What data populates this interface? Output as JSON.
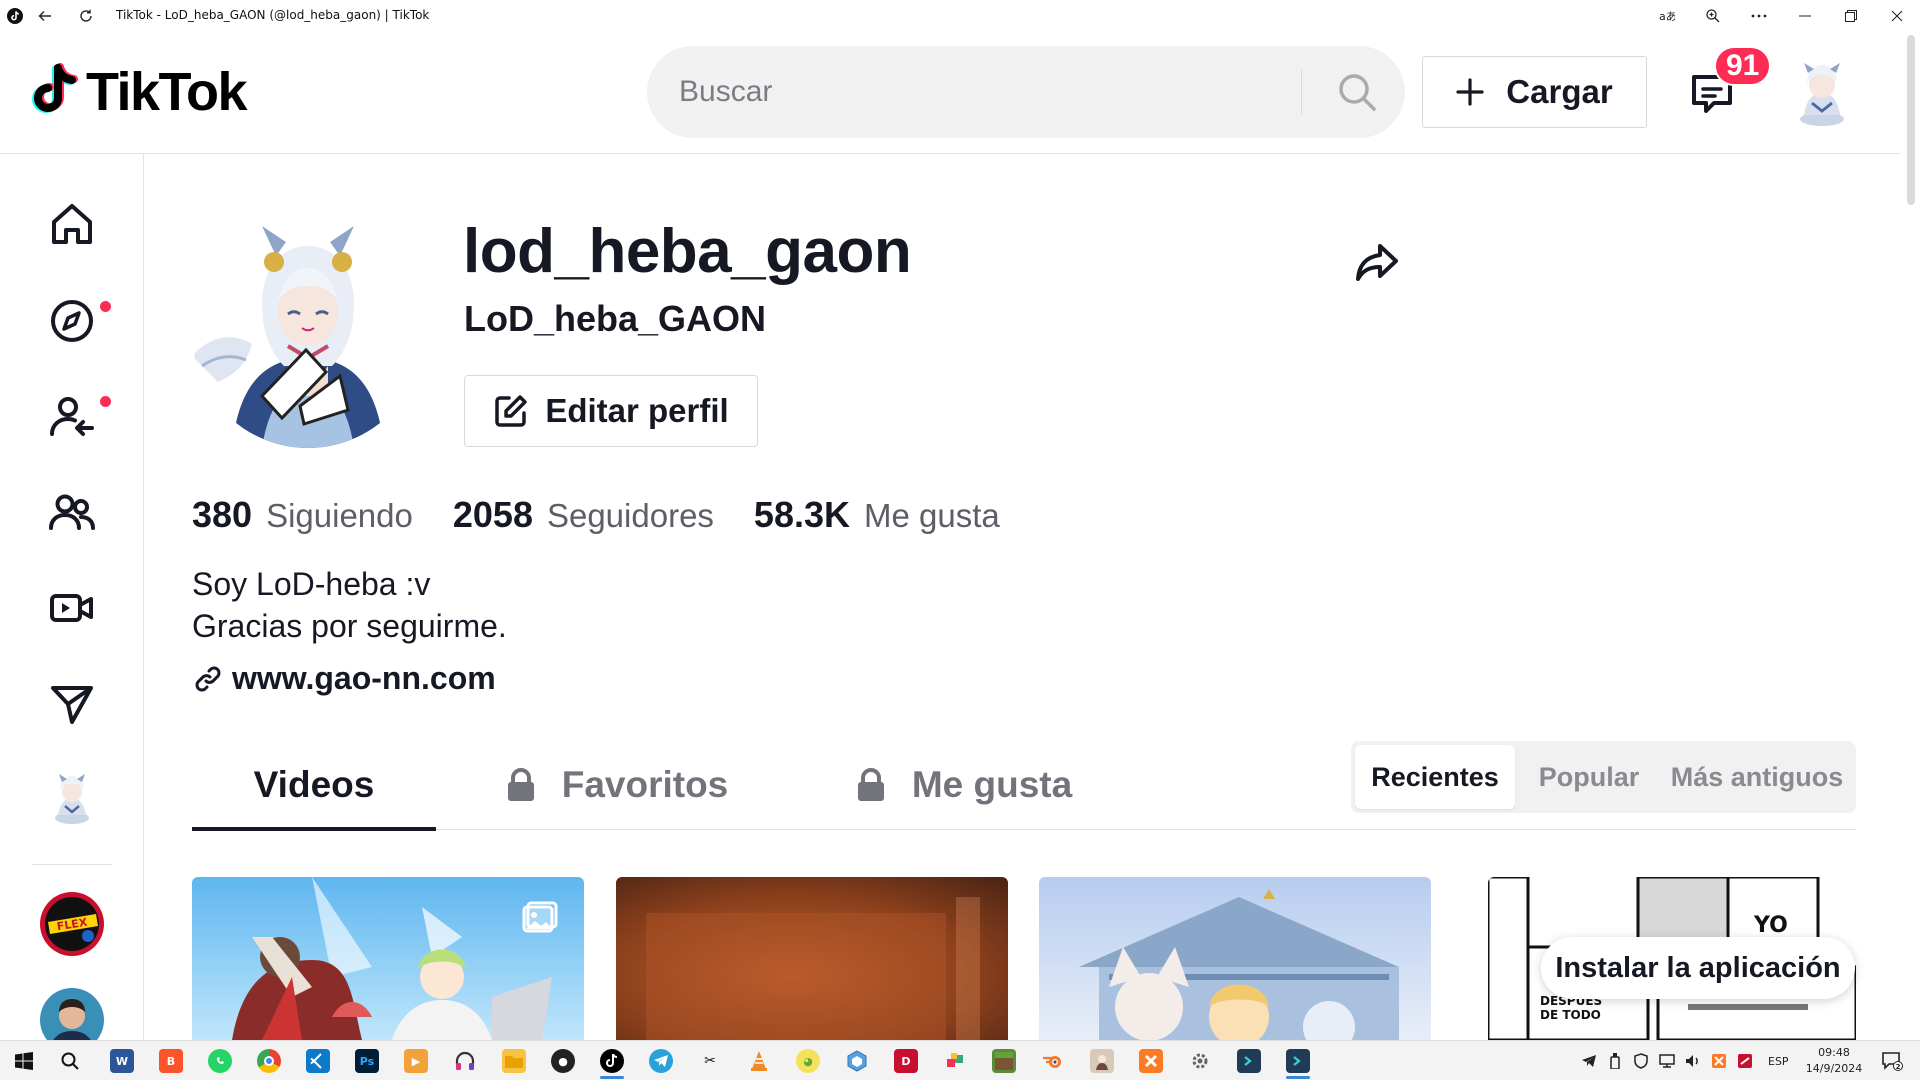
{
  "window": {
    "title": "TikTok - LoD_heba_GAON (@lod_heba_gaon) | TikTok"
  },
  "header": {
    "logo_text": "TikTok",
    "search_placeholder": "Buscar",
    "upload_label": "Cargar",
    "inbox_count": "91"
  },
  "profile": {
    "username": "lod_heba_gaon",
    "nickname": "LoD_heba_GAON",
    "edit_label": "Editar perfil",
    "stats": [
      {
        "value": "380",
        "label": "Siguiendo"
      },
      {
        "value": "2058",
        "label": "Seguidores"
      },
      {
        "value": "58.3K",
        "label": "Me gusta"
      }
    ],
    "bio_lines": [
      "Soy LoD-heba :v",
      "Gracias por seguirme."
    ],
    "link": "www.gao-nn.com"
  },
  "tabs": [
    {
      "label": "Videos",
      "active": true,
      "locked": false
    },
    {
      "label": "Favoritos",
      "active": false,
      "locked": true
    },
    {
      "label": "Me gusta",
      "active": false,
      "locked": true
    }
  ],
  "sort_options": [
    {
      "label": "Recientes",
      "active": true
    },
    {
      "label": "Popular",
      "active": false
    },
    {
      "label": "Más antiguos",
      "active": false
    }
  ],
  "install_label": "Instalar la aplicación",
  "taskbar": {
    "lang": "ESP",
    "time": "09:48",
    "date": "14/9/2024",
    "notification_count": "2"
  },
  "colors": {
    "accent": "#fe2c55",
    "text": "#161823",
    "muted": "#73747b"
  }
}
